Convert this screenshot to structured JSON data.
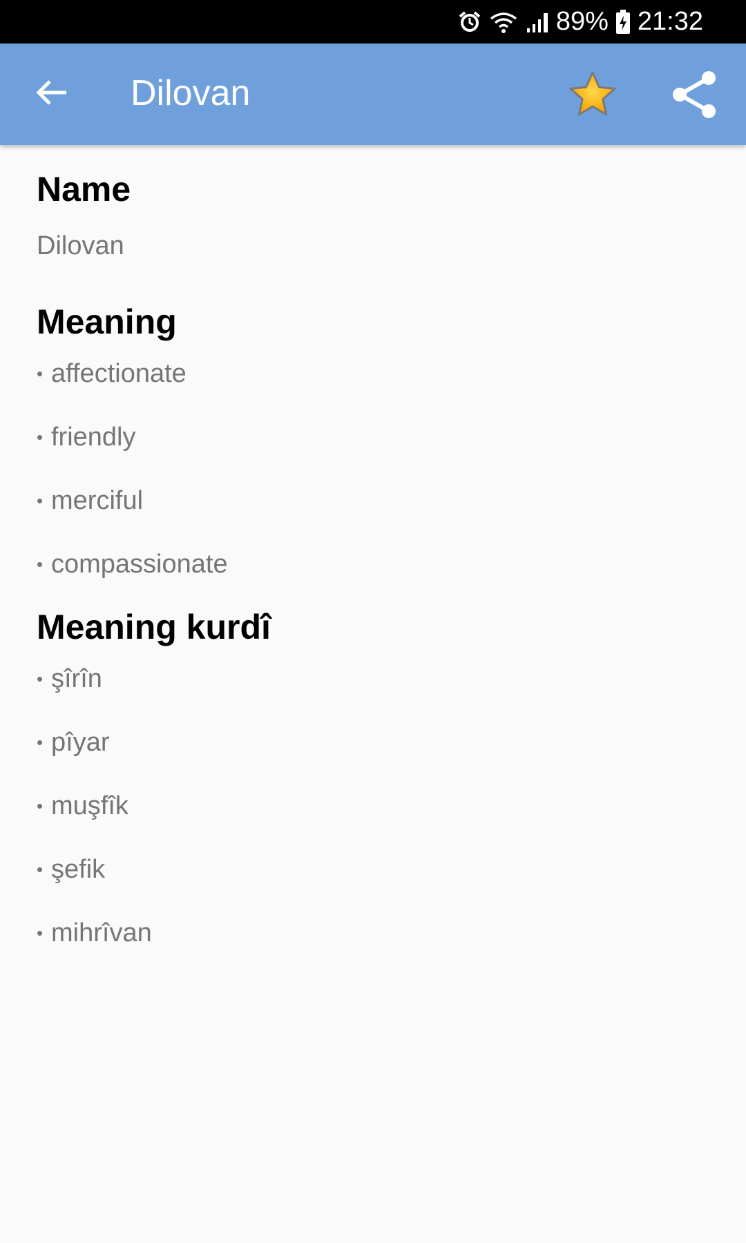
{
  "status_bar": {
    "battery": "89%",
    "time": "21:32",
    "icons": [
      "alarm-icon",
      "wifi-icon",
      "signal-icon",
      "battery-charging-icon"
    ]
  },
  "app_bar": {
    "title": "Dilovan",
    "back_icon": "arrow-back-icon",
    "favorite_icon": "star-icon",
    "share_icon": "share-icon",
    "color": "#6fa0dc"
  },
  "sections": {
    "name": {
      "heading": "Name",
      "value": "Dilovan"
    },
    "meaning": {
      "heading": "Meaning",
      "items": [
        "affectionate",
        "friendly",
        "merciful",
        "compassionate"
      ]
    },
    "meaning_kurdi": {
      "heading": "Meaning kurdî",
      "items": [
        "şîrîn",
        "pîyar",
        "muşfîk",
        "şefik",
        "mihrîvan"
      ]
    }
  }
}
